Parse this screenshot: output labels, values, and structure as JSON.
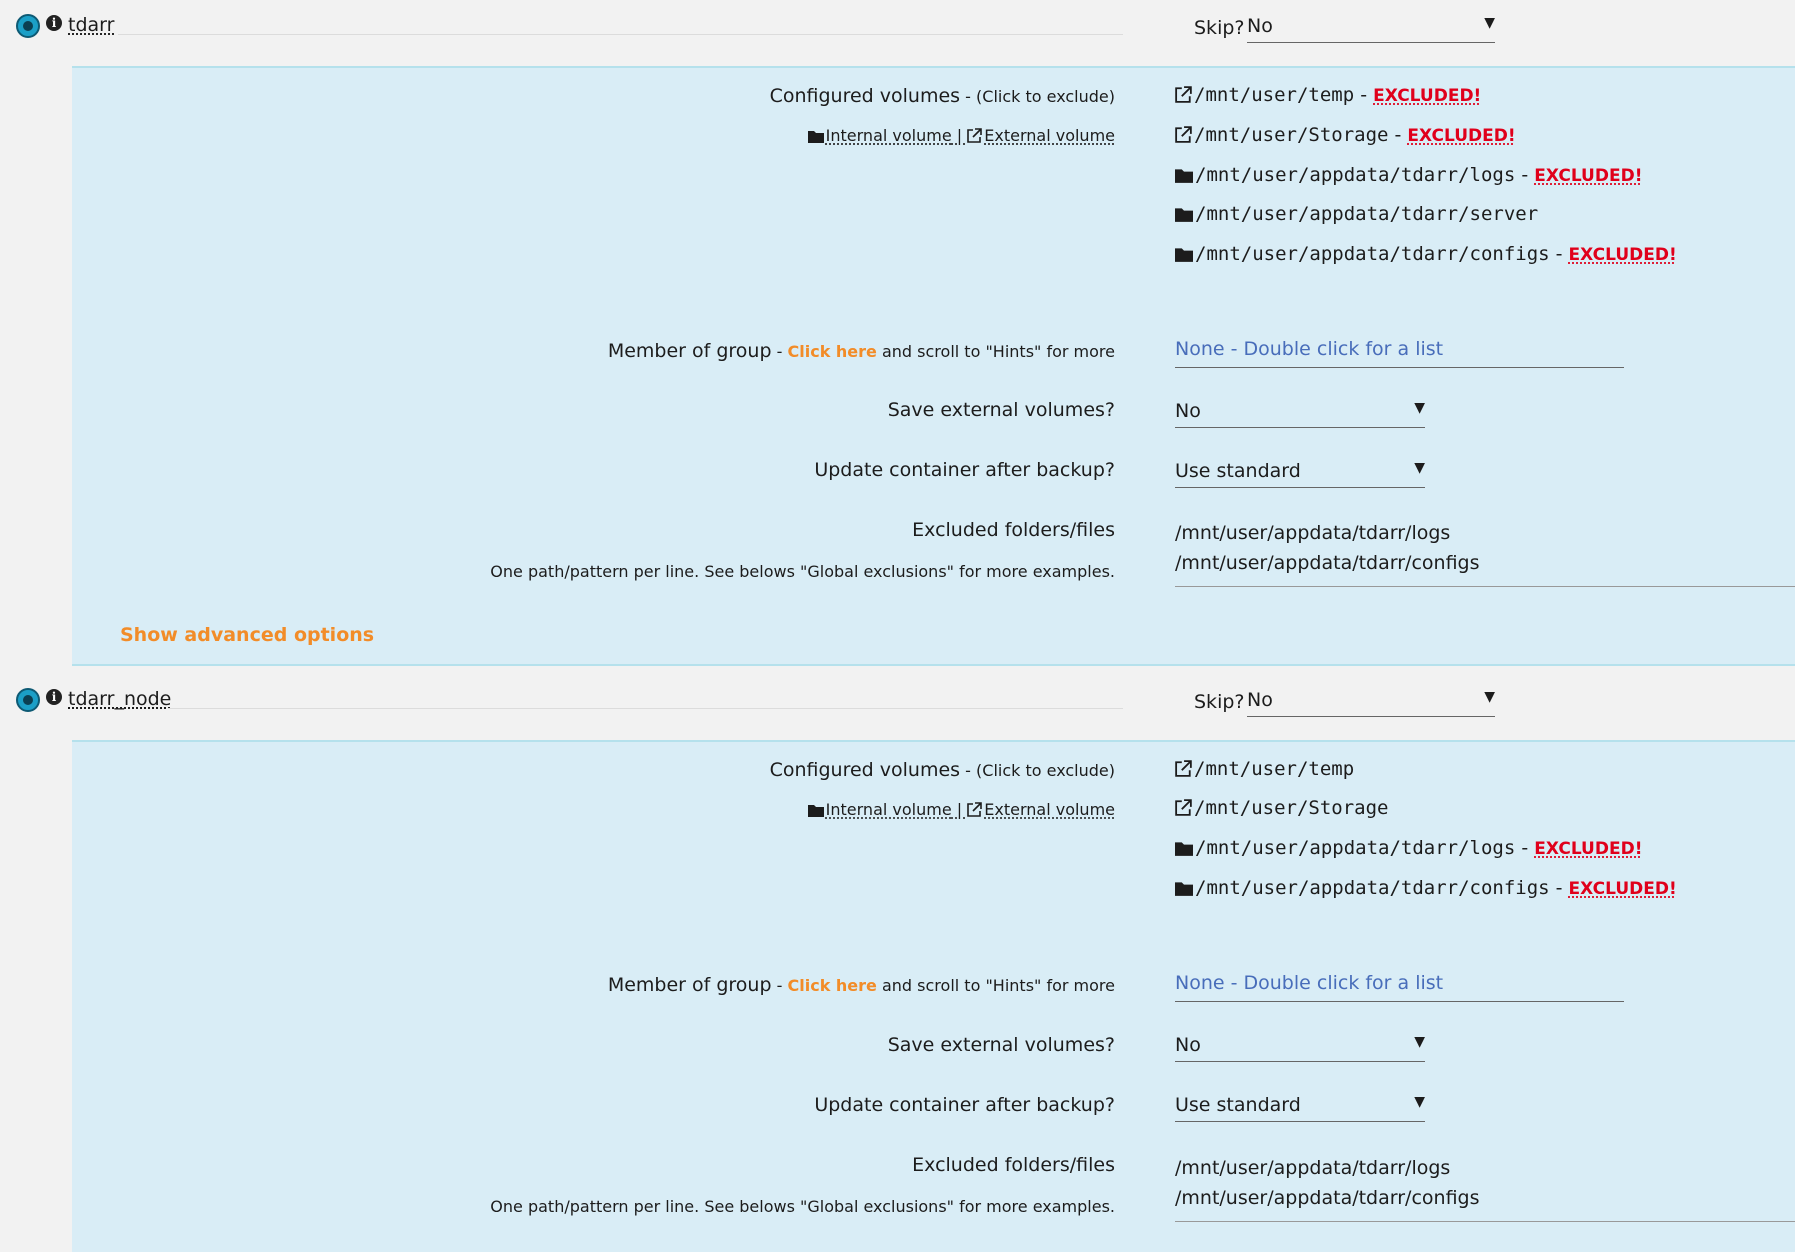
{
  "containers": [
    {
      "name": "tdarr",
      "skip_label": "Skip?",
      "skip_value": "No",
      "configured_volumes_label": "Configured volumes",
      "click_to_exclude": " - (Click to exclude)",
      "legend_internal": "Internal volume",
      "legend_sep": " | ",
      "legend_external": "External volume",
      "volumes": [
        {
          "type": "external",
          "path": "/mnt/user/temp",
          "sep": " - ",
          "status": "EXCLUDED!"
        },
        {
          "type": "external",
          "path": "/mnt/user/Storage",
          "sep": " - ",
          "status": "EXCLUDED!"
        },
        {
          "type": "internal",
          "path": "/mnt/user/appdata/tdarr/logs",
          "sep": " - ",
          "status": "EXCLUDED!"
        },
        {
          "type": "internal",
          "path": "/mnt/user/appdata/tdarr/server",
          "sep": "",
          "status": ""
        },
        {
          "type": "internal",
          "path": "/mnt/user/appdata/tdarr/configs",
          "sep": " - ",
          "status": "EXCLUDED!"
        }
      ],
      "member_of_group_label": "Member of group",
      "group_hint_prefix": " - ",
      "group_hint_link": "Click here",
      "group_hint_suffix": " and scroll to \"Hints\" for more",
      "group_value": "None - Double click for a list",
      "save_external_label": "Save external volumes?",
      "save_external_value": "No",
      "update_label": "Update container after backup?",
      "update_value": "Use standard",
      "excluded_label": "Excluded folders/files",
      "excluded_hint": "One path/pattern per line. See belows \"Global exclusions\" for more examples.",
      "excluded_lines": [
        "/mnt/user/appdata/tdarr/logs",
        "/mnt/user/appdata/tdarr/configs"
      ],
      "advanced_link": "Show advanced options"
    },
    {
      "name": "tdarr_node",
      "skip_label": "Skip?",
      "skip_value": "No",
      "configured_volumes_label": "Configured volumes",
      "click_to_exclude": " - (Click to exclude)",
      "legend_internal": "Internal volume",
      "legend_sep": " | ",
      "legend_external": "External volume",
      "volumes": [
        {
          "type": "external",
          "path": "/mnt/user/temp",
          "sep": "",
          "status": ""
        },
        {
          "type": "external",
          "path": "/mnt/user/Storage",
          "sep": "",
          "status": ""
        },
        {
          "type": "internal",
          "path": "/mnt/user/appdata/tdarr/logs",
          "sep": " - ",
          "status": "EXCLUDED!"
        },
        {
          "type": "internal",
          "path": "/mnt/user/appdata/tdarr/configs",
          "sep": " - ",
          "status": "EXCLUDED!"
        }
      ],
      "member_of_group_label": "Member of group",
      "group_hint_prefix": " - ",
      "group_hint_link": "Click here",
      "group_hint_suffix": " and scroll to \"Hints\" for more",
      "group_value": "None - Double click for a list",
      "save_external_label": "Save external volumes?",
      "save_external_value": "No",
      "update_label": "Update container after backup?",
      "update_value": "Use standard",
      "excluded_label": "Excluded folders/files",
      "excluded_hint": "One path/pattern per line. See belows \"Global exclusions\" for more examples.",
      "excluded_lines": [
        "/mnt/user/appdata/tdarr/logs",
        "/mnt/user/appdata/tdarr/configs"
      ]
    }
  ],
  "icons": {
    "logo": "tdarr-logo-icon",
    "info": "info-circle-icon",
    "folder": "folder-icon",
    "external": "external-link-icon",
    "dropdown": "caret-down-icon"
  },
  "colors": {
    "panel_bg": "#d9edf6",
    "excluded": "#e0001b",
    "link_orange": "#f28c28",
    "group_placeholder": "#486dba"
  }
}
